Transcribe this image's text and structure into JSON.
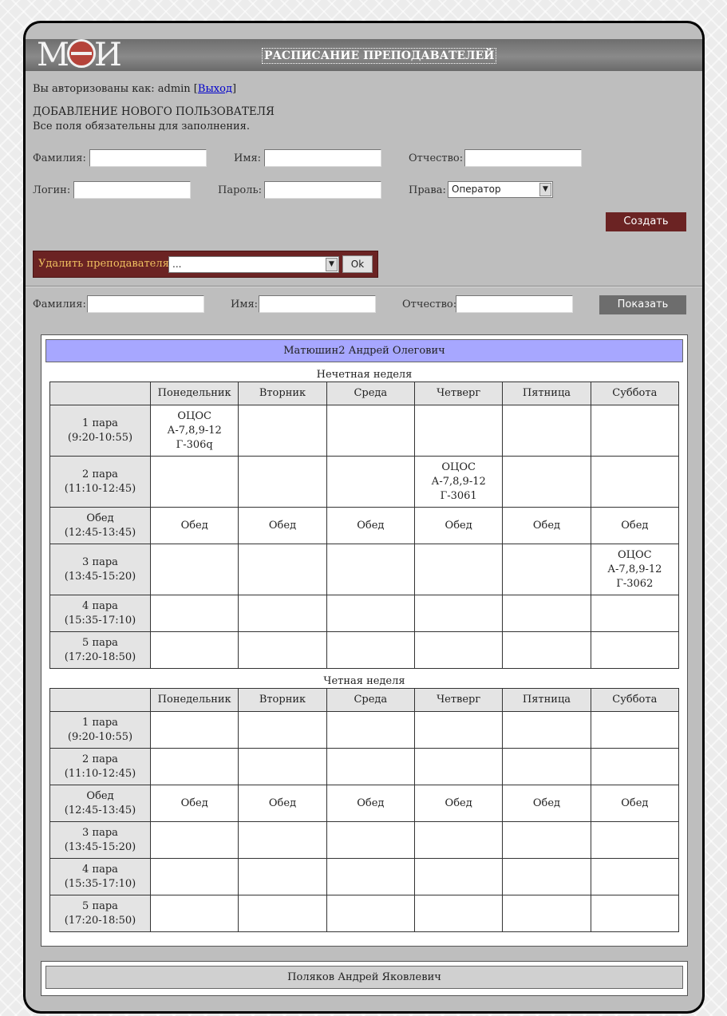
{
  "header": {
    "logo": "МЭИ",
    "title": "РАСПИСАНИЕ ПРЕПОДАВАТЕЛЕЙ"
  },
  "auth": {
    "prefix": "Вы авторизованы как: admin [",
    "logout": "Выход",
    "suffix": "]"
  },
  "add_user": {
    "title": "ДОБАВЛЕНИЕ НОВОГО ПОЛЬЗОВАТЕЛЯ",
    "subtitle": "Все поля обязательны для заполнения.",
    "surname_label": "Фамилия:",
    "name_label": "Имя:",
    "patronymic_label": "Отчество:",
    "login_label": "Логин:",
    "password_label": "Пароль:",
    "rights_label": "Права:",
    "rights_value": "Оператор",
    "create_button": "Создать"
  },
  "delete_teacher": {
    "label": "Удалить преподавателя",
    "selected": "...",
    "ok_button": "Ok"
  },
  "search": {
    "surname_label": "Фамилия:",
    "name_label": "Имя:",
    "patronymic_label": "Отчество:",
    "show_button": "Показать"
  },
  "days": [
    "Понедельник",
    "Вторник",
    "Среда",
    "Четверг",
    "Пятница",
    "Суббота"
  ],
  "teachers": [
    {
      "name": "Матюшин2 Андрей Олегович",
      "weeks": [
        {
          "label": "Нечетная неделя",
          "rows": [
            {
              "slot": "1 пара",
              "time": "(9:20-10:55)",
              "cells": [
                [
                  "ОЦОС",
                  "А-7,8,9-12",
                  "Г-306q"
                ],
                [],
                [],
                [],
                [],
                []
              ]
            },
            {
              "slot": "2 пара",
              "time": "(11:10-12:45)",
              "cells": [
                [],
                [],
                [],
                [
                  "ОЦОС",
                  "А-7,8,9-12",
                  "Г-3061"
                ],
                [],
                []
              ]
            },
            {
              "slot": "Обед",
              "time": "(12:45-13:45)",
              "cells": [
                [
                  "Обед"
                ],
                [
                  "Обед"
                ],
                [
                  "Обед"
                ],
                [
                  "Обед"
                ],
                [
                  "Обед"
                ],
                [
                  "Обед"
                ]
              ]
            },
            {
              "slot": "3 пара",
              "time": "(13:45-15:20)",
              "cells": [
                [],
                [],
                [],
                [],
                [],
                [
                  "ОЦОС",
                  "А-7,8,9-12",
                  "Г-3062"
                ]
              ]
            },
            {
              "slot": "4 пара",
              "time": "(15:35-17:10)",
              "cells": [
                [],
                [],
                [],
                [],
                [],
                []
              ]
            },
            {
              "slot": "5 пара",
              "time": "(17:20-18:50)",
              "cells": [
                [],
                [],
                [],
                [],
                [],
                []
              ]
            }
          ]
        },
        {
          "label": "Четная неделя",
          "rows": [
            {
              "slot": "1 пара",
              "time": "(9:20-10:55)",
              "cells": [
                [],
                [],
                [],
                [],
                [],
                []
              ]
            },
            {
              "slot": "2 пара",
              "time": "(11:10-12:45)",
              "cells": [
                [],
                [],
                [],
                [],
                [],
                []
              ]
            },
            {
              "slot": "Обед",
              "time": "(12:45-13:45)",
              "cells": [
                [
                  "Обед"
                ],
                [
                  "Обед"
                ],
                [
                  "Обед"
                ],
                [
                  "Обед"
                ],
                [
                  "Обед"
                ],
                [
                  "Обед"
                ]
              ]
            },
            {
              "slot": "3 пара",
              "time": "(13:45-15:20)",
              "cells": [
                [],
                [],
                [],
                [],
                [],
                []
              ]
            },
            {
              "slot": "4 пара",
              "time": "(15:35-17:10)",
              "cells": [
                [],
                [],
                [],
                [],
                [],
                []
              ]
            },
            {
              "slot": "5 пара",
              "time": "(17:20-18:50)",
              "cells": [
                [],
                [],
                [],
                [],
                [],
                []
              ]
            }
          ]
        }
      ]
    },
    {
      "name": "Поляков Андрей Яковлевич"
    }
  ]
}
